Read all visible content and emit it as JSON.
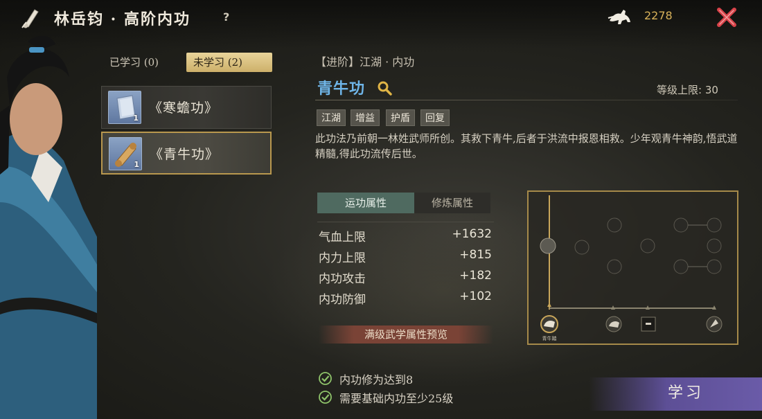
{
  "header": {
    "title": "林岳钧 · 高阶内功",
    "help_label": "?",
    "currency_value": "2278"
  },
  "tabs": [
    {
      "label": "已学习 (0)"
    },
    {
      "label": "未学习 (2)"
    }
  ],
  "skill_list": [
    {
      "name": "《寒蟾功》",
      "count": "1"
    },
    {
      "name": "《青牛功》",
      "count": "1"
    }
  ],
  "detail": {
    "category": "【进阶】江湖 · 内功",
    "title": "青牛功",
    "level_limit": "等级上限: 30",
    "tags": [
      "江湖",
      "增益",
      "护盾",
      "回复"
    ],
    "description": "此功法乃前朝一林姓武师所创。其救下青牛,后者于洪流中报恩相救。少年观青牛神韵,悟武道精髓,得此功流传后世。"
  },
  "attr_tabs": [
    {
      "label": "运功属性"
    },
    {
      "label": "修炼属性"
    }
  ],
  "attributes": [
    {
      "label": "气血上限",
      "value": "+1632"
    },
    {
      "label": "内力上限",
      "value": "+815"
    },
    {
      "label": "内功攻击",
      "value": "+182"
    },
    {
      "label": "内功防御",
      "value": "+102"
    }
  ],
  "preview_label": "满级武学属性预览",
  "graph_nodes": [
    "青牛踏"
  ],
  "requirements": [
    {
      "text": "内功修为达到8"
    },
    {
      "text": "需要基础内功至少25级"
    }
  ],
  "learn_label": "学习",
  "colors": {
    "accent_gold": "#b9984e",
    "skill_title_blue": "#6fb5e8",
    "tab_active": "#4f6a60",
    "check_green": "#8fc46a"
  }
}
